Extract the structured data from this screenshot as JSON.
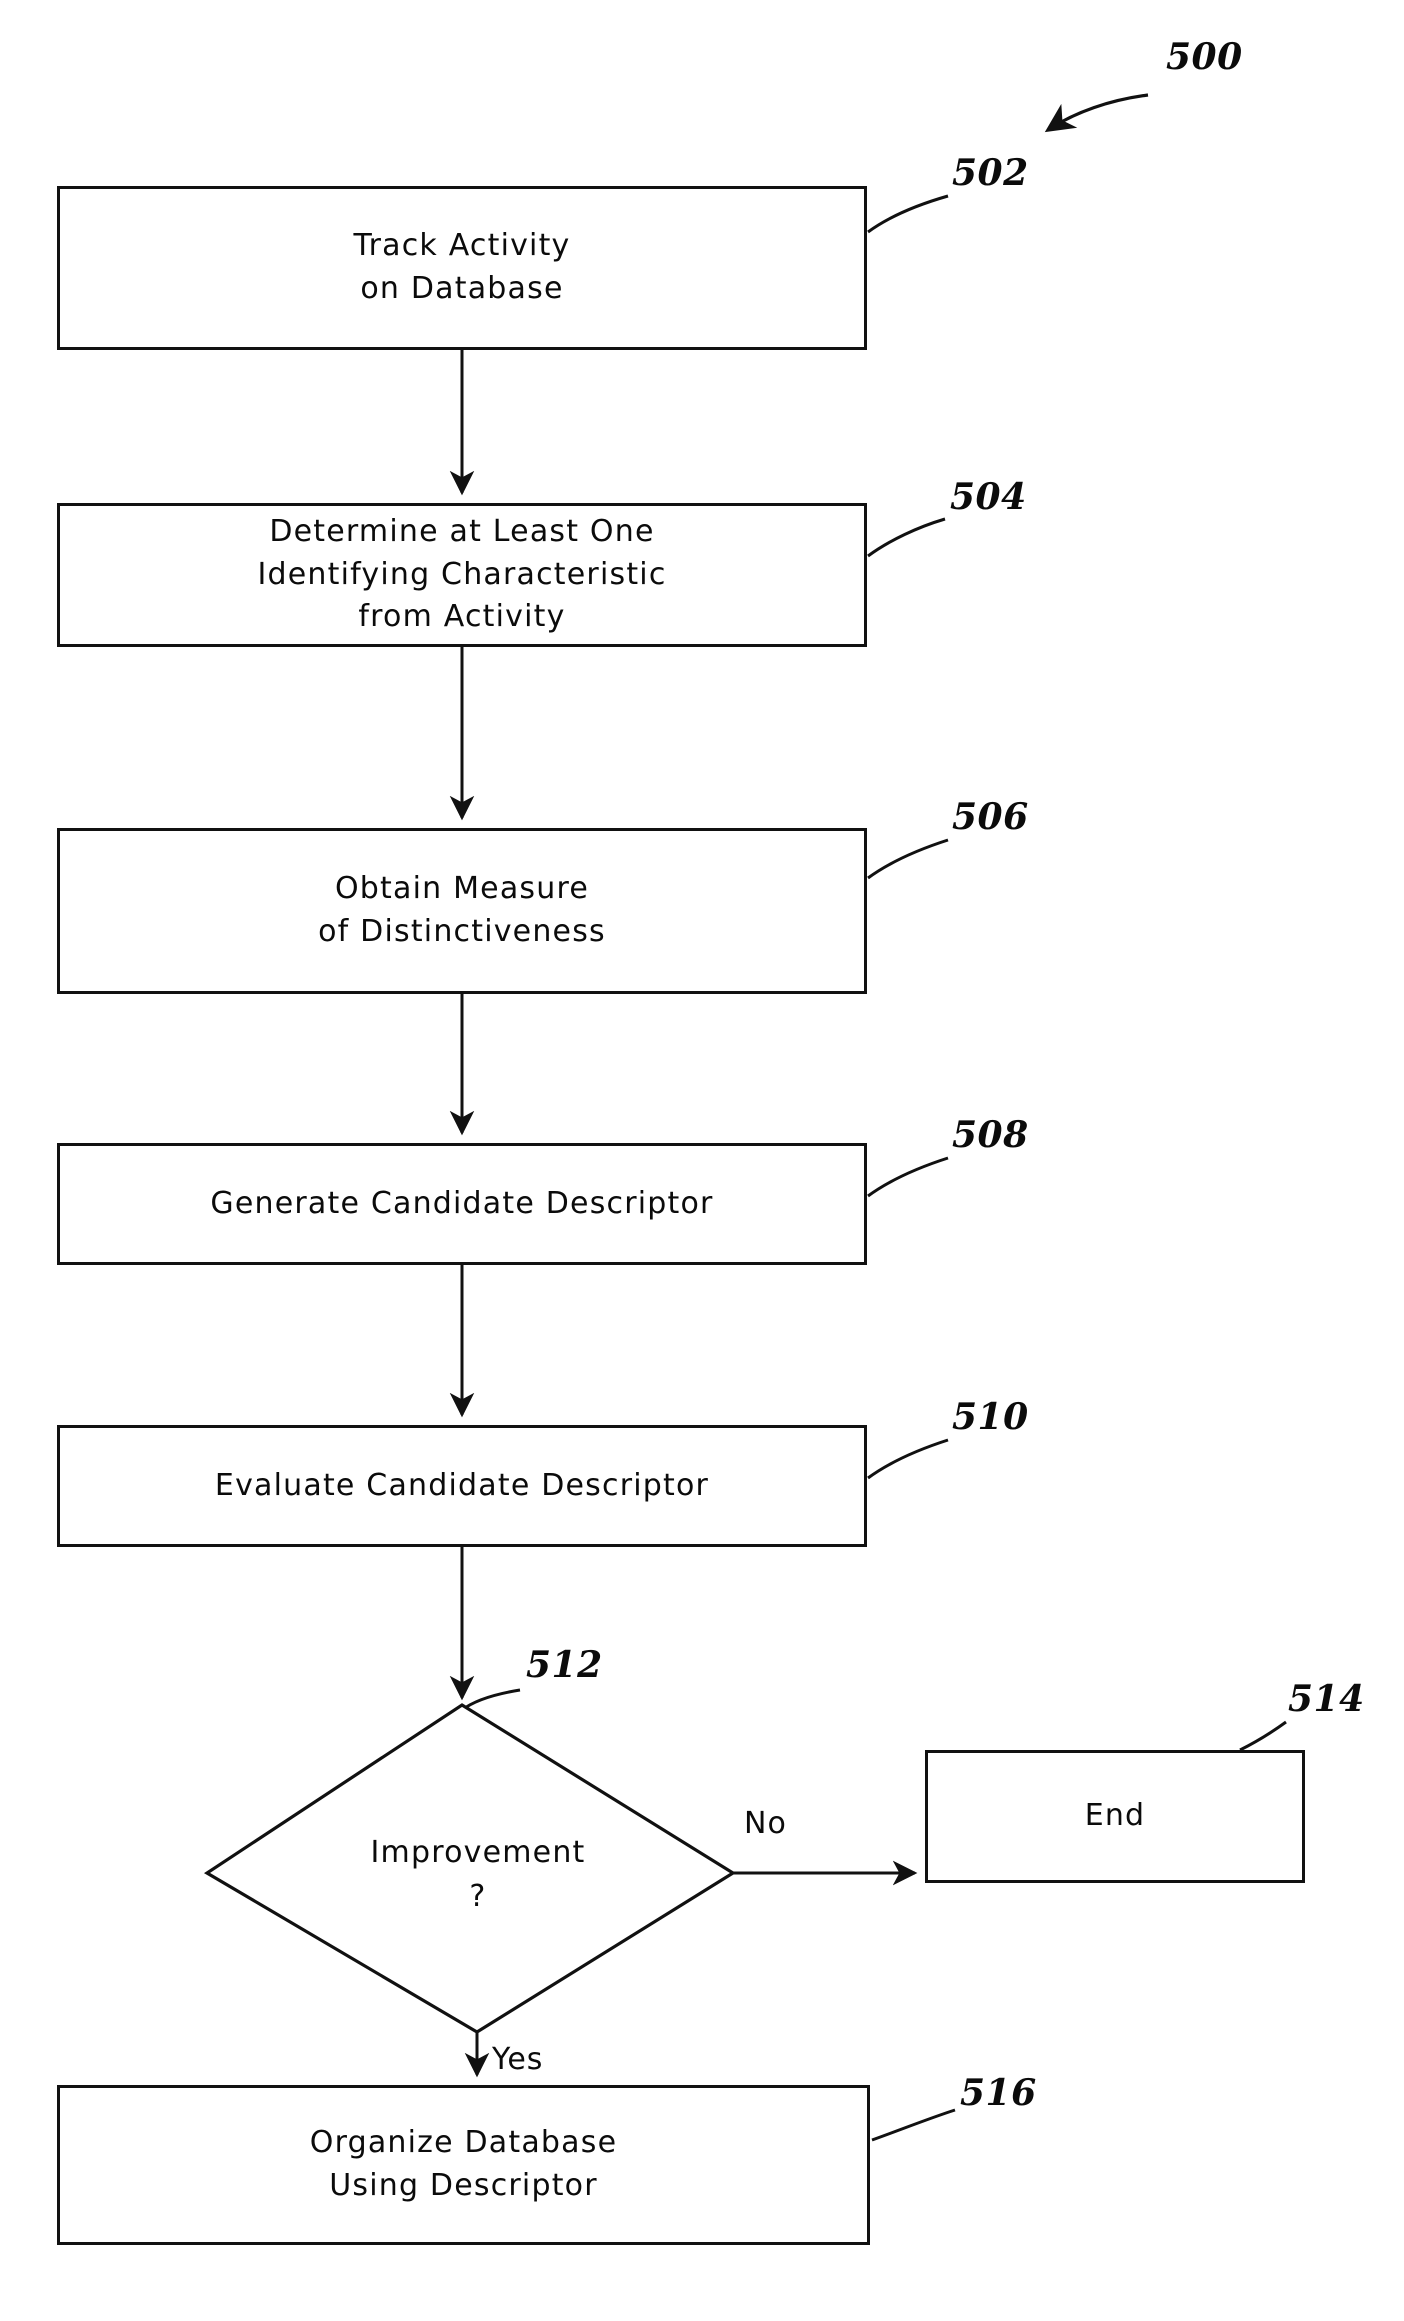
{
  "figure": {
    "number": "500",
    "type": "patent-flowchart"
  },
  "nodes": [
    {
      "id": "502",
      "ref": "502",
      "shape": "process",
      "text": "Track Activity\non Database"
    },
    {
      "id": "504",
      "ref": "504",
      "shape": "process",
      "text": "Determine at Least One\nIdentifying Characteristic\nfrom Activity"
    },
    {
      "id": "506",
      "ref": "506",
      "shape": "process",
      "text": "Obtain Measure\nof Distinctiveness"
    },
    {
      "id": "508",
      "ref": "508",
      "shape": "process",
      "text": "Generate Candidate Descriptor"
    },
    {
      "id": "510",
      "ref": "510",
      "shape": "process",
      "text": "Evaluate Candidate Descriptor"
    },
    {
      "id": "512",
      "ref": "512",
      "shape": "decision",
      "text": "Improvement\n?"
    },
    {
      "id": "514",
      "ref": "514",
      "shape": "terminator",
      "text": "End"
    },
    {
      "id": "516",
      "ref": "516",
      "shape": "process",
      "text": "Organize Database\nUsing Descriptor"
    }
  ],
  "edge_labels": {
    "no": "No",
    "yes": "Yes"
  }
}
